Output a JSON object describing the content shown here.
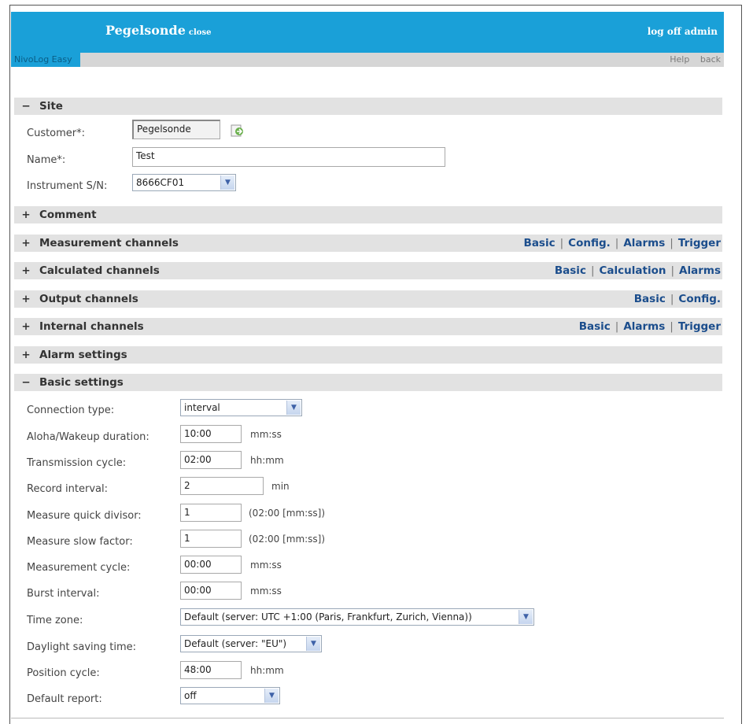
{
  "header": {
    "title": "Pegelsonde",
    "close_label": "close",
    "logoff_label": "log off admin",
    "app_name": "NivoLog Easy",
    "help_label": "Help",
    "back_label": "back"
  },
  "sections": {
    "site": {
      "toggle": "−",
      "label": "Site"
    },
    "comment": {
      "toggle": "+",
      "label": "Comment"
    },
    "measurement": {
      "toggle": "+",
      "label": "Measurement channels",
      "links": [
        "Basic",
        "Config.",
        "Alarms",
        "Trigger"
      ]
    },
    "calculated": {
      "toggle": "+",
      "label": "Calculated channels",
      "links": [
        "Basic",
        "Calculation",
        "Alarms"
      ]
    },
    "output": {
      "toggle": "+",
      "label": "Output channels",
      "links": [
        "Basic",
        "Config."
      ]
    },
    "internal": {
      "toggle": "+",
      "label": "Internal channels",
      "links": [
        "Basic",
        "Alarms",
        "Trigger"
      ]
    },
    "alarm": {
      "toggle": "+",
      "label": "Alarm settings"
    },
    "basic": {
      "toggle": "−",
      "label": "Basic settings"
    }
  },
  "site": {
    "customer_label": "Customer*:",
    "customer_value": "Pegelsonde",
    "name_label": "Name*:",
    "name_value": "Test",
    "instrument_label": "Instrument S/N:",
    "instrument_value": "8666CF01"
  },
  "basic": {
    "connection_type": {
      "label": "Connection type:",
      "value": "interval"
    },
    "aloha": {
      "label": "Aloha/Wakeup duration:",
      "value": "10:00",
      "unit": "mm:ss"
    },
    "transmission": {
      "label": "Transmission cycle:",
      "value": "02:00",
      "unit": "hh:mm"
    },
    "record": {
      "label": "Record interval:",
      "value": "2",
      "unit": "min"
    },
    "quick_divisor": {
      "label": "Measure quick divisor:",
      "value": "1",
      "unit": "(02:00 [mm:ss])"
    },
    "slow_factor": {
      "label": "Measure slow factor:",
      "value": "1",
      "unit": "(02:00 [mm:ss])"
    },
    "measurement_cycle": {
      "label": "Measurement cycle:",
      "value": "00:00",
      "unit": "mm:ss"
    },
    "burst": {
      "label": "Burst interval:",
      "value": "00:00",
      "unit": "mm:ss"
    },
    "time_zone": {
      "label": "Time zone:",
      "value": "Default (server: UTC +1:00 (Paris, Frankfurt, Zurich, Vienna))"
    },
    "dst": {
      "label": "Daylight saving time:",
      "value": "Default (server: \"EU\")"
    },
    "position": {
      "label": "Position cycle:",
      "value": "48:00",
      "unit": "hh:mm"
    },
    "report": {
      "label": "Default report:",
      "value": "off"
    }
  },
  "colors": {
    "accent": "#1aa0d8",
    "section_bg": "#e2e2e2",
    "link": "#1b4d8c"
  }
}
